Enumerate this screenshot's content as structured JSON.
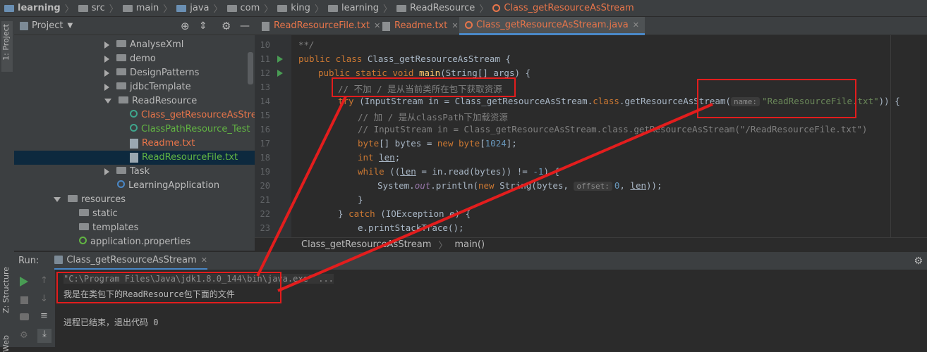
{
  "breadcrumb": [
    "learning",
    "src",
    "main",
    "java",
    "com",
    "king",
    "learning",
    "ReadResource",
    "Class_getResourceAsStream"
  ],
  "left_stripe": {
    "project_tab": "1: Project",
    "structure_tab": "Z: Structure",
    "web_tab": "Web"
  },
  "project_panel": {
    "title": "Project",
    "tree": [
      {
        "label": "AnalyseXml",
        "type": "folder",
        "expanded": false
      },
      {
        "label": "demo",
        "type": "folder",
        "expanded": false
      },
      {
        "label": "DesignPatterns",
        "type": "folder",
        "expanded": false
      },
      {
        "label": "jdbcTemplate",
        "type": "folder",
        "expanded": false
      },
      {
        "label": "ReadResource",
        "type": "folder",
        "expanded": true
      },
      {
        "label": "Class_getResourceAsStream",
        "type": "class",
        "color": "#e8754a"
      },
      {
        "label": "ClassPathResource_Test",
        "type": "class",
        "color": "#62b543"
      },
      {
        "label": "Readme.txt",
        "type": "file",
        "color": "#e8754a"
      },
      {
        "label": "ReadResourceFile.txt",
        "type": "file",
        "color": "#62b543",
        "selected": true
      },
      {
        "label": "Task",
        "type": "folder",
        "expanded": false
      },
      {
        "label": "LearningApplication",
        "type": "class",
        "color": "#bbbbbb"
      },
      {
        "label": "resources",
        "type": "folder",
        "expanded": true
      },
      {
        "label": "static",
        "type": "folder"
      },
      {
        "label": "templates",
        "type": "folder"
      },
      {
        "label": "application.properties",
        "type": "file",
        "color": "#bbbbbb"
      }
    ]
  },
  "editor_tabs": [
    {
      "label": "ReadResourceFile.txt",
      "color": "#e8754a",
      "active": false
    },
    {
      "label": "Readme.txt",
      "color": "#e8754a",
      "active": false
    },
    {
      "label": "Class_getResourceAsStream.java",
      "color": "#e8754a",
      "active": true
    }
  ],
  "code": {
    "line_numbers": [
      "10",
      "11",
      "12",
      "13",
      "14",
      "15",
      "16",
      "17",
      "18",
      "19",
      "20",
      "21",
      "22",
      "23"
    ],
    "l10": "**/",
    "l11_kw": "public class ",
    "l11_name": "Class_getResourceAsStream {",
    "l12_kw": "public static void ",
    "l12_fn": "main",
    "l12_rest": "(String[] args) {",
    "l13": "// 不加 / 是从当前类所在包下获取资源",
    "l14_kw": "try ",
    "l14_a": "(InputStream in = Class_getResourceAsStream.",
    "l14_class": "class",
    "l14_b": ".getResourceAsStream(",
    "l14_hint": "name:",
    "l14_str": "\"ReadResourceFile.txt\"",
    "l14_c": ")) {",
    "l15": "// 加 / 是从classPath下加载资源",
    "l16": "// InputStream in = Class_getResourceAsStream.class.getResourceAsStream(\"/ReadResourceFile.txt\")",
    "l17_a": "byte",
    "l17_b": "[] bytes = ",
    "l17_new": "new ",
    "l17_c": "byte",
    "l17_d": "[",
    "l17_num": "1024",
    "l17_e": "];",
    "l18_kw": "int ",
    "l18_var": "len",
    "l18_e": ";",
    "l19_kw": "while ",
    "l19_a": "((",
    "l19_var": "len",
    "l19_b": " = in.read(bytes)) != ",
    "l19_num": "-1",
    "l19_c": ") {",
    "l20_a": "System.",
    "l20_out": "out",
    "l20_b": ".println(",
    "l20_new": "new ",
    "l20_c": "String(bytes, ",
    "l20_hint": "offset:",
    "l20_num": "0",
    "l20_d": ", ",
    "l20_var": "len",
    "l20_e": "));",
    "l21": "}",
    "l22_a": "} ",
    "l22_kw": "catch ",
    "l22_b": "(IOException e) {",
    "l23": "e.printStackTrace();"
  },
  "code_breadcrumb": [
    "Class_getResourceAsStream",
    "main()"
  ],
  "run_panel": {
    "label": "Run:",
    "tab": "Class_getResourceAsStream",
    "console": [
      "\"C:\\Program Files\\Java\\jdk1.8.0_144\\bin\\java.exe\" ...",
      "我是在类包下的ReadResource包下面的文件",
      "",
      "进程已结束，退出代码 0"
    ]
  },
  "colors": {
    "annotation": "#e31d1d",
    "keyword": "#cc7832",
    "string": "#6a8759",
    "comment": "#808080"
  }
}
